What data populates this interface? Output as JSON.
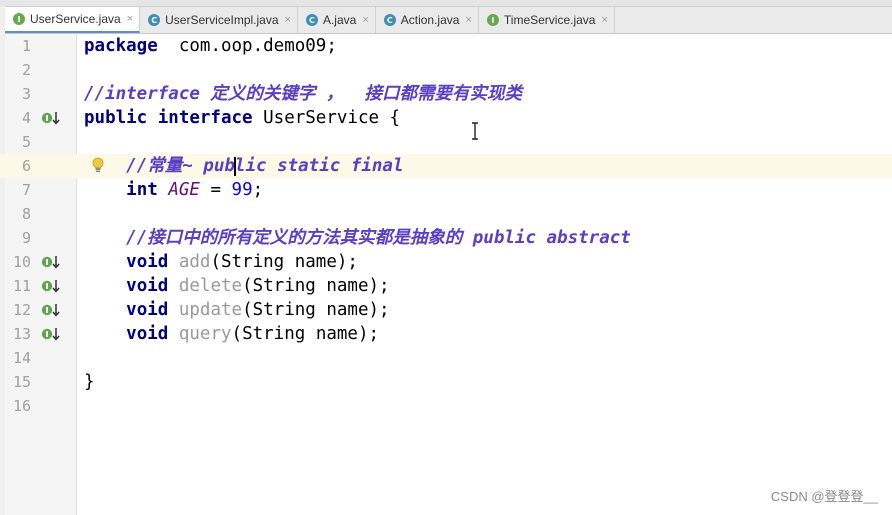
{
  "tabs": [
    {
      "label": "UserService.java",
      "type": "I",
      "active": true
    },
    {
      "label": "UserServiceImpl.java",
      "type": "C",
      "active": false
    },
    {
      "label": "A.java",
      "type": "C",
      "active": false
    },
    {
      "label": "Action.java",
      "type": "C",
      "active": false
    },
    {
      "label": "TimeService.java",
      "type": "I",
      "active": false
    }
  ],
  "close_glyph": "×",
  "current_line": 6,
  "lines": [
    {
      "n": "1",
      "tokens": [
        [
          "kw",
          "package"
        ],
        [
          "",
          "  com.oop.demo09;"
        ]
      ]
    },
    {
      "n": "2",
      "tokens": []
    },
    {
      "n": "3",
      "tokens": [
        [
          "cm",
          "//interface 定义的关键字 ，  接口都需要有实现类"
        ]
      ]
    },
    {
      "n": "4",
      "marker": "implemented",
      "tokens": [
        [
          "kw",
          "public interface "
        ],
        [
          "",
          "UserService {"
        ]
      ]
    },
    {
      "n": "5",
      "tokens": []
    },
    {
      "n": "6",
      "bulb": true,
      "tokens": [
        [
          "",
          "    "
        ],
        [
          "cm",
          "//常量~ pub"
        ],
        [
          "caret",
          ""
        ],
        [
          "cm",
          "lic static final"
        ]
      ]
    },
    {
      "n": "7",
      "tokens": [
        [
          "",
          "    "
        ],
        [
          "kw",
          "int "
        ],
        [
          "const",
          "AGE"
        ],
        [
          "",
          " = "
        ],
        [
          "num",
          "99"
        ],
        [
          "",
          ";"
        ]
      ]
    },
    {
      "n": "8",
      "tokens": []
    },
    {
      "n": "9",
      "tokens": [
        [
          "",
          "    "
        ],
        [
          "cm",
          "//接口中的所有定义的方法其实都是抽象的 public abstract"
        ]
      ]
    },
    {
      "n": "10",
      "marker": "implemented",
      "tokens": [
        [
          "",
          "    "
        ],
        [
          "kw",
          "void "
        ],
        [
          "unused",
          "add"
        ],
        [
          "",
          "(String name);"
        ]
      ]
    },
    {
      "n": "11",
      "marker": "implemented",
      "tokens": [
        [
          "",
          "    "
        ],
        [
          "kw",
          "void "
        ],
        [
          "unused",
          "delete"
        ],
        [
          "",
          "(String name);"
        ]
      ]
    },
    {
      "n": "12",
      "marker": "implemented",
      "tokens": [
        [
          "",
          "    "
        ],
        [
          "kw",
          "void "
        ],
        [
          "unused",
          "update"
        ],
        [
          "",
          "(String name);"
        ]
      ]
    },
    {
      "n": "13",
      "marker": "implemented",
      "tokens": [
        [
          "",
          "    "
        ],
        [
          "kw",
          "void "
        ],
        [
          "unused",
          "query"
        ],
        [
          "",
          "(String name);"
        ]
      ]
    },
    {
      "n": "14",
      "tokens": []
    },
    {
      "n": "15",
      "tokens": [
        [
          "",
          "}"
        ]
      ]
    },
    {
      "n": "16",
      "tokens": []
    }
  ],
  "watermark": "CSDN @登登登__"
}
